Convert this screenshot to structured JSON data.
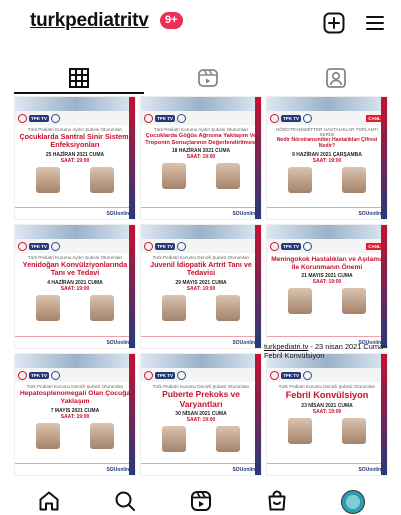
{
  "header": {
    "username": "turkpediatritv",
    "badge": "9+",
    "colors": {
      "badge": "#ef2d55",
      "brand_red": "#c8102e",
      "brand_blue": "#243b7a"
    }
  },
  "tabs": [
    {
      "name": "grid",
      "icon": "grid-icon",
      "active": true
    },
    {
      "name": "reels",
      "icon": "reels-icon"
    },
    {
      "name": "tagged",
      "icon": "tagged-icon"
    }
  ],
  "posts": [
    {
      "head": "Türk Pediatri Kurumu Aydın Şubesi Oturumları",
      "title": "Çocuklarda Santral Sinir Sistemi Enfeksiyonları",
      "date": "25 HAZİRAN 2021 CUMA",
      "time": "SAAT: 19:00"
    },
    {
      "head": "Türk Pediatri Kurumu Aydın Şubesi Oturumları",
      "title": "Çocuklarda Göğüs Ağrısına Yaklaşım Ve Troponin Sonuçlarının Değerlendirilmesi",
      "date": "18 HAZİRAN 2021 CUMA",
      "time": "SAAT: 19:00"
    },
    {
      "head": "NÖROTRANSMİTTER HASTALIKLAR TOPLANTI SERİSİ",
      "title": "Nedir Nörotransmitter Hastalıkları Çifresi Nedir?",
      "date": "9 HAZİRAN 2021 ÇARŞAMBA",
      "time": "SAAT: 19:00"
    },
    {
      "head": "Türk Pediatri Kurumu Aydın Şubesi Oturumları",
      "title": "Yenidoğan Konvülziyonlarında Tanı ve Tedavi",
      "date": "4 HAZİRAN 2021 CUMA",
      "time": "SAAT: 19:00"
    },
    {
      "head": "Türk Pediatri Kurumu Denizli Şubesi Oturumları",
      "title": "Juvenil İdiopatik Artrit Tanı ve Tedavisi",
      "date": "29 MAYIS 2021 CUMA",
      "time": "SAAT: 19:00"
    },
    {
      "head": "",
      "title": "Meningokok Hastalıkları ve Aşılama İle Korunmanın Önemi",
      "date": "21 MAYIS 2021 CUMA",
      "time": "SAAT: 19:00"
    },
    {
      "head": "Türk Pediatri Kurumu Denizli Şubesi Oturumları",
      "title": "Hepatosplenomegali Olan Çocuğa Yaklaşım",
      "date": "7 MAYIS 2021 CUMA",
      "time": "SAAT: 19:00"
    },
    {
      "head": "Türk Pediatri Kurumu Denizli Şubesi Oturumları",
      "title": "Puberte Prekoks ve Varyantları",
      "date": "30 NİSAN 2021 CUMA",
      "time": "SAAT: 19:00"
    },
    {
      "head": "Türk Pediatri Kurumu Denizli Şubesi Oturumları",
      "title": "Febril Konvülsiyon",
      "date": "23 NİSAN 2021 CUMA",
      "time": "SAAT: 19:00"
    }
  ],
  "footer_brand": "SOUonline",
  "caption": {
    "account": "turkpediatri.tv",
    "text": " - 23 nisan 2021 Cuma - Febril Konvülsiyon"
  },
  "nav": [
    "home-icon",
    "search-icon",
    "reels-icon",
    "shop-icon",
    "profile-avatar"
  ]
}
